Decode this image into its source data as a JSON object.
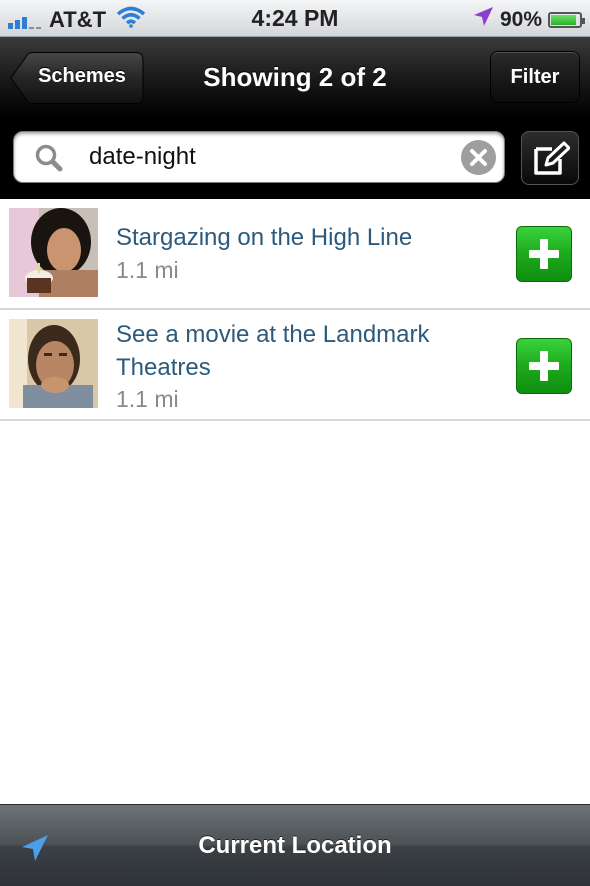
{
  "status_bar": {
    "carrier": "AT&T",
    "time": "4:24 PM",
    "battery_percent": "90%",
    "battery_level": 0.9
  },
  "nav": {
    "back_label": "Schemes",
    "title": "Showing 2 of 2",
    "filter_label": "Filter"
  },
  "search": {
    "value": "date-night",
    "placeholder": ""
  },
  "results": [
    {
      "title": "Stargazing on the High Line",
      "distance": "1.1 mi"
    },
    {
      "title": "See a movie at the Landmark Theatres",
      "distance": "1.1 mi"
    }
  ],
  "bottom_bar": {
    "label": "Current Location"
  },
  "colors": {
    "accent_title": "#2b5a7c",
    "add_green": "#1caa1c",
    "location_blue": "#4a9fe8"
  }
}
